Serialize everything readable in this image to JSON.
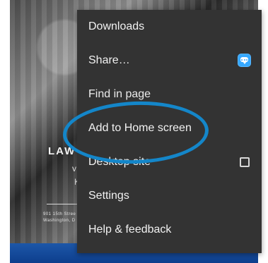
{
  "background_page": {
    "title": "LAW",
    "subtitle_1": "v",
    "subtitle_2": "K",
    "address_line_1": "901 15th Stree",
    "address_line_2": "Washington, D"
  },
  "menu": {
    "items": [
      {
        "label": "Downloads"
      },
      {
        "label": "Share…",
        "icon": "share-app-icon"
      },
      {
        "label": "Find in page"
      },
      {
        "label": "Add to Home screen"
      },
      {
        "label": "Desktop site",
        "control": "checkbox",
        "checked": false
      },
      {
        "label": "Settings"
      },
      {
        "label": "Help & feedback"
      }
    ]
  },
  "annotation": {
    "highlight_color": "#1486c9"
  }
}
